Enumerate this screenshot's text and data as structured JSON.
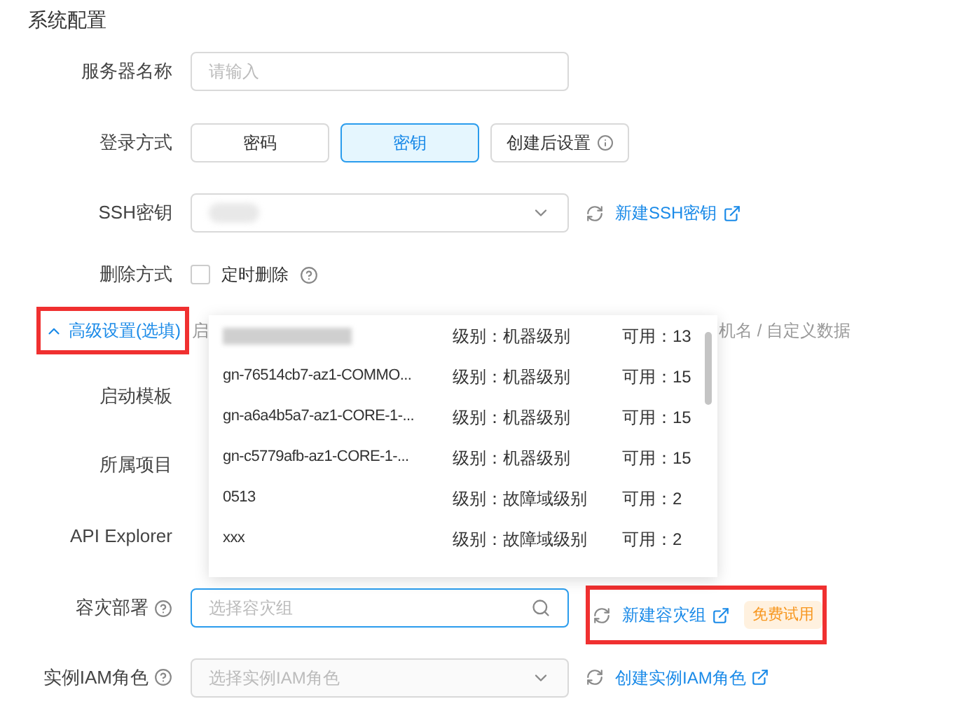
{
  "section_title": "系统配置",
  "server_name": {
    "label": "服务器名称",
    "placeholder": "请输入"
  },
  "login": {
    "label": "登录方式",
    "options": [
      {
        "label": "密码",
        "selected": false,
        "has_info": false
      },
      {
        "label": "密钥",
        "selected": true,
        "has_info": false
      },
      {
        "label": "创建后设置",
        "selected": false,
        "has_info": true
      }
    ]
  },
  "ssh_key": {
    "label": "SSH密钥",
    "link": "新建SSH密钥"
  },
  "delete": {
    "label": "删除方式",
    "option": {
      "label": "定时删除",
      "checked": false
    }
  },
  "advanced": {
    "label": "高级设置(选填)",
    "expanded": true,
    "summary_left": "启",
    "summary_right": "机名 / 自定义数据"
  },
  "fields": [
    {
      "label": "启动模板"
    },
    {
      "label": "所属项目"
    },
    {
      "label": "API Explorer"
    }
  ],
  "dropdown": {
    "items": [
      {
        "kind": "blurred",
        "tier": "级别：机器级别",
        "available": "可用：13"
      },
      {
        "kind": "text",
        "name": "gn-76514cb7-az1-COMMO...",
        "tier": "级别：机器级别",
        "available": "可用：15"
      },
      {
        "kind": "text",
        "name": "gn-a6a4b5a7-az1-CORE-1-...",
        "tier": "级别：机器级别",
        "available": "可用：15"
      },
      {
        "kind": "text",
        "name": "gn-c5779afb-az1-CORE-1-...",
        "tier": "级别：机器级别",
        "available": "可用：15"
      },
      {
        "kind": "text",
        "name": "0513",
        "tier": "级别：故障域级别",
        "available": "可用：2"
      },
      {
        "kind": "text",
        "name": "xxx",
        "tier": "级别：故障域级别",
        "available": "可用：2"
      }
    ]
  },
  "disaster": {
    "label": "容灾部署",
    "placeholder": "选择容灾组",
    "focused": true,
    "link": "新建容灾组",
    "badge": "免费试用"
  },
  "iam": {
    "label": "实例IAM角色",
    "placeholder": "选择实例IAM角色",
    "link": "创建实例IAM角色"
  }
}
